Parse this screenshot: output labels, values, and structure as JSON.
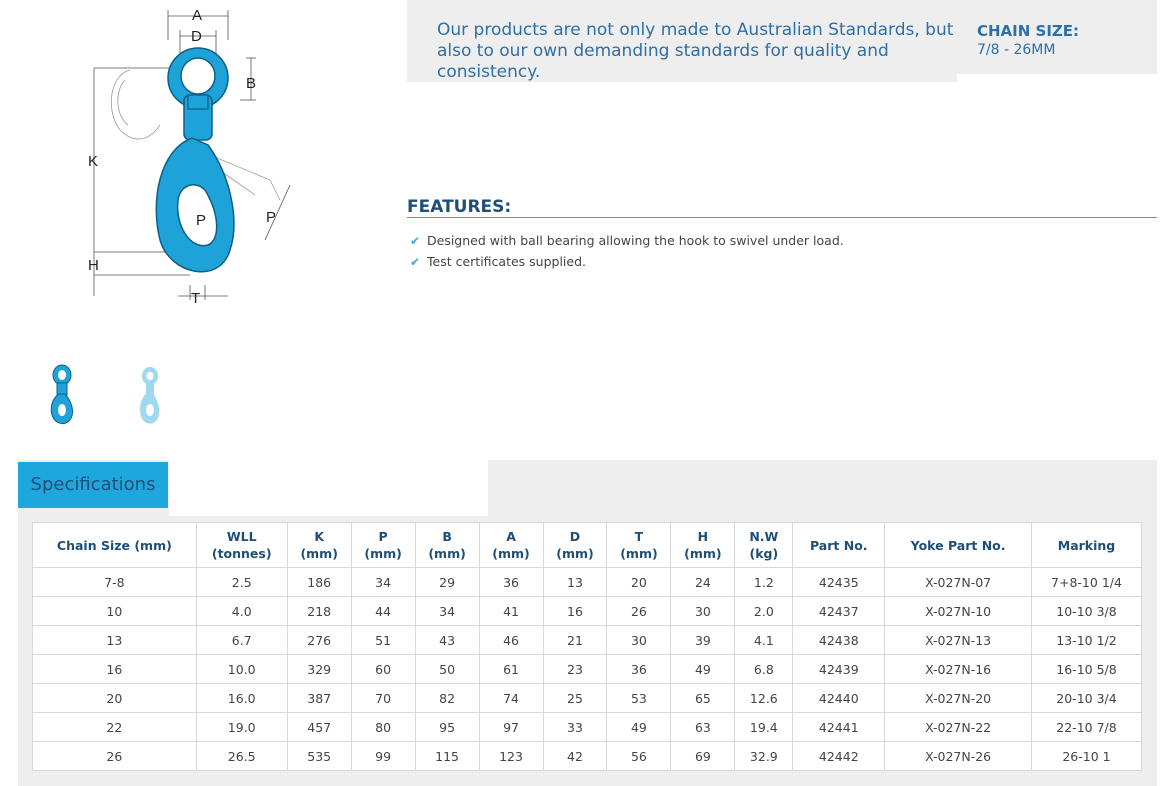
{
  "diagram": {
    "labels": {
      "a": "A",
      "d": "D",
      "b": "B",
      "k": "K",
      "p_inner": "P",
      "p_outer": "P",
      "h": "H",
      "t": "T"
    },
    "hook_color": "#1ea3d8"
  },
  "intro": {
    "text": "Our products are not only made to Australian Standards, but also to our own demanding standards for quality and consistency."
  },
  "chain_size": {
    "title": "CHAIN SIZE:",
    "value": "7/8 - 26MM"
  },
  "features": {
    "title": "FEATURES:",
    "items": [
      {
        "icon": "check-icon",
        "text": "Designed with ball bearing allowing the hook to swivel under load."
      },
      {
        "icon": "check-icon",
        "text": "Test certificates supplied."
      }
    ]
  },
  "specifications": {
    "tab_label": "Specifications",
    "headers": [
      [
        "Chain Size (mm)"
      ],
      [
        "WLL",
        "(tonnes)"
      ],
      [
        "K",
        "(mm)"
      ],
      [
        "P",
        "(mm)"
      ],
      [
        "B",
        "(mm)"
      ],
      [
        "A",
        "(mm)"
      ],
      [
        "D",
        "(mm)"
      ],
      [
        "T",
        "(mm)"
      ],
      [
        "H",
        "(mm)"
      ],
      [
        "N.W",
        "(kg)"
      ],
      [
        "Part No."
      ],
      [
        "Yoke Part No."
      ],
      [
        "Marking"
      ]
    ],
    "rows": [
      [
        "7-8",
        "2.5",
        "186",
        "34",
        "29",
        "36",
        "13",
        "20",
        "24",
        "1.2",
        "42435",
        "X-027N-07",
        "7+8-10 1/4"
      ],
      [
        "10",
        "4.0",
        "218",
        "44",
        "34",
        "41",
        "16",
        "26",
        "30",
        "2.0",
        "42437",
        "X-027N-10",
        "10-10 3/8"
      ],
      [
        "13",
        "6.7",
        "276",
        "51",
        "43",
        "46",
        "21",
        "30",
        "39",
        "4.1",
        "42438",
        "X-027N-13",
        "13-10 1/2"
      ],
      [
        "16",
        "10.0",
        "329",
        "60",
        "50",
        "61",
        "23",
        "36",
        "49",
        "6.8",
        "42439",
        "X-027N-16",
        "16-10 5/8"
      ],
      [
        "20",
        "16.0",
        "387",
        "70",
        "82",
        "74",
        "25",
        "53",
        "65",
        "12.6",
        "42440",
        "X-027N-20",
        "20-10 3/4"
      ],
      [
        "22",
        "19.0",
        "457",
        "80",
        "95",
        "97",
        "33",
        "49",
        "63",
        "19.4",
        "42441",
        "X-027N-22",
        "22-10 7/8"
      ],
      [
        "26",
        "26.5",
        "535",
        "99",
        "115",
        "123",
        "42",
        "56",
        "69",
        "32.9",
        "42442",
        "X-027N-26",
        "26-10 1"
      ]
    ]
  },
  "colors": {
    "accent": "#1ea7dc",
    "heading": "#1f4e79",
    "intro_text": "#2e6fa8"
  }
}
